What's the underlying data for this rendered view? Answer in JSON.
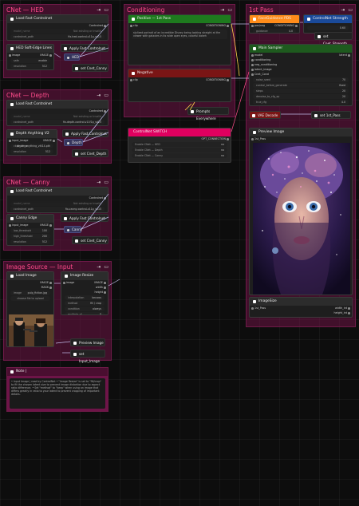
{
  "groups": {
    "hed": {
      "title": "CNet — HED"
    },
    "depth": {
      "title": "CNet — Depth"
    },
    "canny": {
      "title": "CNet — Canny"
    },
    "source": {
      "title": "Image Source — Input"
    },
    "conditioning": {
      "title": "Conditioning"
    },
    "firstpass": {
      "title": "1st Pass"
    },
    "icons": "⇥ ▭"
  },
  "hed": {
    "loader": {
      "title": "Load Fast Controlnet",
      "output": "Controlnet",
      "model_name": "model_name",
      "model_value": "Not existing or Invalid",
      "controlnet_path": "controlnet_path",
      "controlnet_value": "fix-hed-control-v11p_sd15"
    },
    "pre": {
      "title": "HED Soft-Edge Lines",
      "in_image": "image",
      "out_image": "IMAGE",
      "w1": "safe",
      "w1v": "enable",
      "w2": "resolution",
      "w2v": "512"
    },
    "apply": "Apply Fast Controlnet",
    "sub": "HED",
    "set": "set Cnet_Canny"
  },
  "depth": {
    "loader": {
      "title": "Load Fast Controlnet",
      "output": "Controlnet",
      "model_name": "model_name",
      "model_value": "Not existing or Invalid",
      "controlnet_path": "controlnet_path",
      "controlnet_value": "fix-depth-control-v11f1p_sd15"
    },
    "pre": {
      "title": "Depth Anything V2",
      "in_image": "input_image",
      "out_image": "IMAGE",
      "w1": "ckpt_name",
      "w1v": "depth_anything_vitl14.pth",
      "w2": "resolution",
      "w2v": "512"
    },
    "apply": "Apply Fast Controlnet",
    "sub": "Depth",
    "set": "set Cnet_Depth"
  },
  "canny": {
    "loader": {
      "title": "Load Fast Controlnet",
      "output": "Controlnet",
      "model_name": "model_name",
      "model_value": "Not existing or Invalid",
      "controlnet_path": "controlnet_path",
      "controlnet_value": "fix-canny-control-v11p_sd15"
    },
    "pre": {
      "title": "Canny Edge",
      "in_image": "input_image",
      "out_image": "IMAGE",
      "w1": "low_threshold",
      "w1v": "100",
      "w2": "high_threshold",
      "w2v": "200",
      "w3": "resolution",
      "w3v": "512"
    },
    "apply": "Apply Fast Controlnet",
    "sub": "Canny",
    "set": "set Cnet_Canny"
  },
  "source": {
    "load": {
      "title": "Load Image",
      "out1": "IMAGE",
      "out2": "MASK",
      "image_label": "image",
      "image_value": "pulp_fiction.jpg",
      "upload": "choose file to upload"
    },
    "resize": {
      "title": "Image Resize",
      "in": "image",
      "o1": "IMAGE",
      "o2": "width",
      "o3": "height",
      "w1": "interpolation",
      "w1v": "lanczos",
      "w2": "method",
      "w2v": "fill / crop",
      "w3": "condition",
      "w3v": "always",
      "w4": "multiple_of",
      "w4v": "8"
    },
    "preview": "Preview Image",
    "set": "set Input_Image"
  },
  "conditioning": {
    "positive": {
      "title": "Positive — 1st Pass",
      "clip": "clip",
      "out": "CONDITIONING",
      "text": "stylized portrait of an incredible Disney being looking straight at the viewer with galaxies in its wide open eyes, colorful bokeh"
    },
    "negative": {
      "title": "Negative",
      "clip": "clip",
      "out": "CONDITIONING"
    },
    "prompts": "Prompts Everywhere",
    "switch": {
      "title": "ControlNet SWITCH",
      "out": "OPT_CONNECTION",
      "r1": "Enable CNet — HED",
      "r2": "Enable CNet — Depth",
      "r3": "Enable CNet — Canny",
      "r1v": "no",
      "r2v": "no",
      "r3v": "no"
    }
  },
  "firstpass": {
    "fd": {
      "title": "FaceGuidance PDS",
      "in": "pos/neg",
      "out": "CONDITIONING",
      "w": "guidance",
      "wv": "4.0"
    },
    "cs": {
      "title": "ControlNet Strength",
      "v": "0.60"
    },
    "set_strength": "set Cnet_Strength",
    "sampler": {
      "title": "Main Sampler",
      "inputs": [
        "model",
        "conditioning",
        "neg_conditioning",
        "latent_image",
        "Cnet_Cond"
      ],
      "out": "latent",
      "widgets": [
        {
          "l": "noise_seed",
          "v": "70"
        },
        {
          "l": "control_before_generate",
          "v": "fixed"
        },
        {
          "l": "steps",
          "v": "20"
        },
        {
          "l": "denoise_to_cfg_xp",
          "v": "20"
        },
        {
          "l": "true_cfg",
          "v": "4.0"
        }
      ]
    },
    "vae": "VAE Decode",
    "set_pass": "set 1st_Pass",
    "preview": {
      "title": "Preview Image",
      "in": "1st_Pass"
    },
    "size": {
      "title": "ImageSize",
      "in": "1st_Pass",
      "o1": "width_int",
      "o2": "height_int"
    }
  },
  "note": {
    "title": "Note |",
    "text": "• Input Image | read by ControlNet • \"Image Resize\" is set to \"fill/crop\" to fit the chosen latent size to prevent image distortion due to aspect ratio difference. • Set \"method\" to \"keep\" when using an image that differs greatly in ratio to your latent to prevent cropping of important details."
  },
  "colors": {
    "group": "#6e1448",
    "title": "#ff4c8b",
    "green": "#1e7a1e",
    "red": "#7a1515",
    "accent": "#e0005f",
    "orange": "#ff8c1a",
    "blue": "#1a4a9a"
  }
}
